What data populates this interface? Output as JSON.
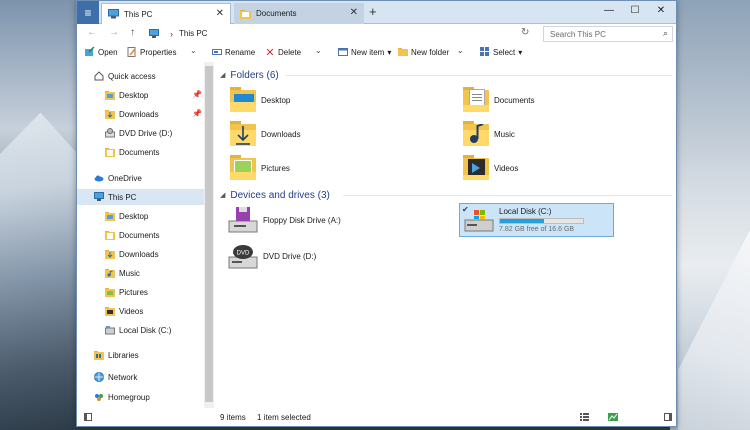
{
  "window": {
    "tabs": [
      {
        "label": "This PC",
        "close": "✕"
      },
      {
        "label": "Documents",
        "close": "✕"
      }
    ],
    "new_tab": "+",
    "controls": {
      "minimize": "—",
      "maximize": "☐",
      "close": "✕"
    }
  },
  "address": {
    "back": "←",
    "forward": "→",
    "up": "↑",
    "chevron": "›",
    "path": "This PC",
    "refresh": "↻",
    "search_placeholder": "Search This PC",
    "search_icon": "⌕"
  },
  "toolbar": {
    "open": "Open",
    "properties": "Properties",
    "rename": "Rename",
    "delete": "Delete",
    "new_item": "New item",
    "new_folder": "New folder",
    "select": "Select",
    "dropdown": "⌄",
    "select_dropdown": "▾"
  },
  "nav": {
    "quick_access": "Quick access",
    "quick_items": [
      {
        "label": "Desktop",
        "pinned": true
      },
      {
        "label": "Downloads",
        "pinned": true
      },
      {
        "label": "DVD Drive (D:)"
      },
      {
        "label": "Documents"
      }
    ],
    "pin": "📌",
    "onedrive": "OneDrive",
    "this_pc": "This PC",
    "pc_items": [
      "Desktop",
      "Documents",
      "Downloads",
      "Music",
      "Pictures",
      "Videos",
      "Local Disk (C:)"
    ],
    "libraries": "Libraries",
    "network": "Network",
    "homegroup": "Homegroup"
  },
  "content": {
    "folders_header": "Folders (6)",
    "folders": [
      "Desktop",
      "Documents",
      "Downloads",
      "Music",
      "Pictures",
      "Videos"
    ],
    "devices_header": "Devices and drives (3)",
    "drives": [
      {
        "label": "Floppy Disk Drive (A:)"
      },
      {
        "label": "Local Disk (C:)",
        "free": "7.82 GB free of 16.6 GB",
        "used_fraction": 0.53,
        "selected": true
      },
      {
        "label": "DVD Drive (D:)"
      }
    ],
    "collapse_icon": "◢",
    "check": "✔",
    "dvd_text": "DVD"
  },
  "status": {
    "items": "9 items",
    "selected": "1 item selected"
  },
  "colors": {
    "accent": "#3f6fa8",
    "folder": "#f2c44d",
    "selection": "#cce4f7",
    "bar_fill": "#26a0da"
  }
}
